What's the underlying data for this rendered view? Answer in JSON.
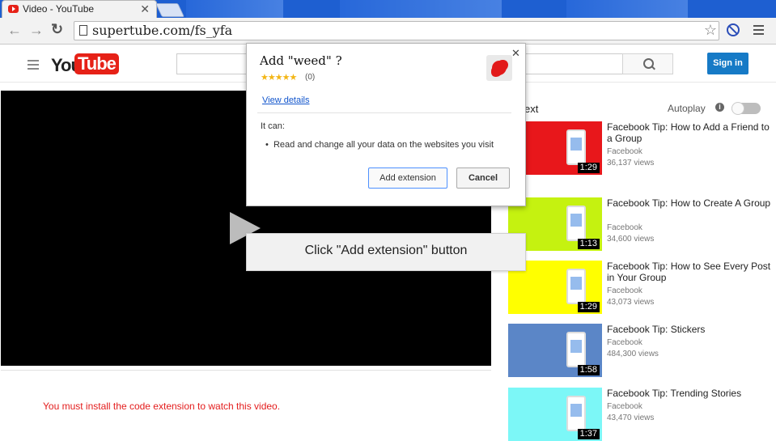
{
  "browser": {
    "tab_title": "Video - YouTube",
    "tab_close": "✕",
    "url": "supertube.com/fs_yfa",
    "back_icon": "back-arrow-icon",
    "forward_icon": "forward-arrow-icon",
    "reload_icon": "reload-icon",
    "bookmark_icon": "star-icon",
    "extension_icon": "stop-sign-icon",
    "menu_icon": "hamburger-menu-icon"
  },
  "youtube": {
    "logo_you": "You",
    "logo_tube": "Tube",
    "search_placeholder": "",
    "signin_label": "Sign in",
    "warning_text": "You must install the code   extension to watch this video.",
    "up_next": "ext",
    "autoplay_label": "Autoplay",
    "autoplay_info": "i",
    "brand_red": "#e62117",
    "signin_blue": "#167ac6"
  },
  "videos": [
    {
      "title": "Facebook Tip: How to Add a Friend to a Group",
      "channel": "Facebook",
      "views": "36,137 views",
      "duration": "1:29",
      "thumb_color": "#e8171b"
    },
    {
      "title": "Facebook Tip: How to Create A Group",
      "channel": "Facebook",
      "views": "34,600 views",
      "duration": "1:13",
      "thumb_color": "#c5f210"
    },
    {
      "title": "Facebook Tip: How to See Every Post in Your Group",
      "channel": "Facebook",
      "views": "43,073 views",
      "duration": "1:29",
      "thumb_color": "#ffff00"
    },
    {
      "title": "Facebook Tip: Stickers",
      "channel": "Facebook",
      "views": "484,300 views",
      "duration": "1:58",
      "thumb_color": "#5b86c7"
    },
    {
      "title": "Facebook Tip: Trending Stories",
      "channel": "Facebook",
      "views": "43,470 views",
      "duration": "1:37",
      "thumb_color": "#7cf7f7"
    }
  ],
  "dialog": {
    "title": "Add \"weed\" ?",
    "rating_stars": "★★★★★",
    "rating_count": "(0)",
    "view_details": "View details",
    "it_can": "It can:",
    "permission": "Read and change all your data on the websites you visit",
    "add_button": "Add extension",
    "cancel_button": "Cancel",
    "close": "✕"
  },
  "callout": {
    "text": "Click \"Add extension\" button"
  }
}
